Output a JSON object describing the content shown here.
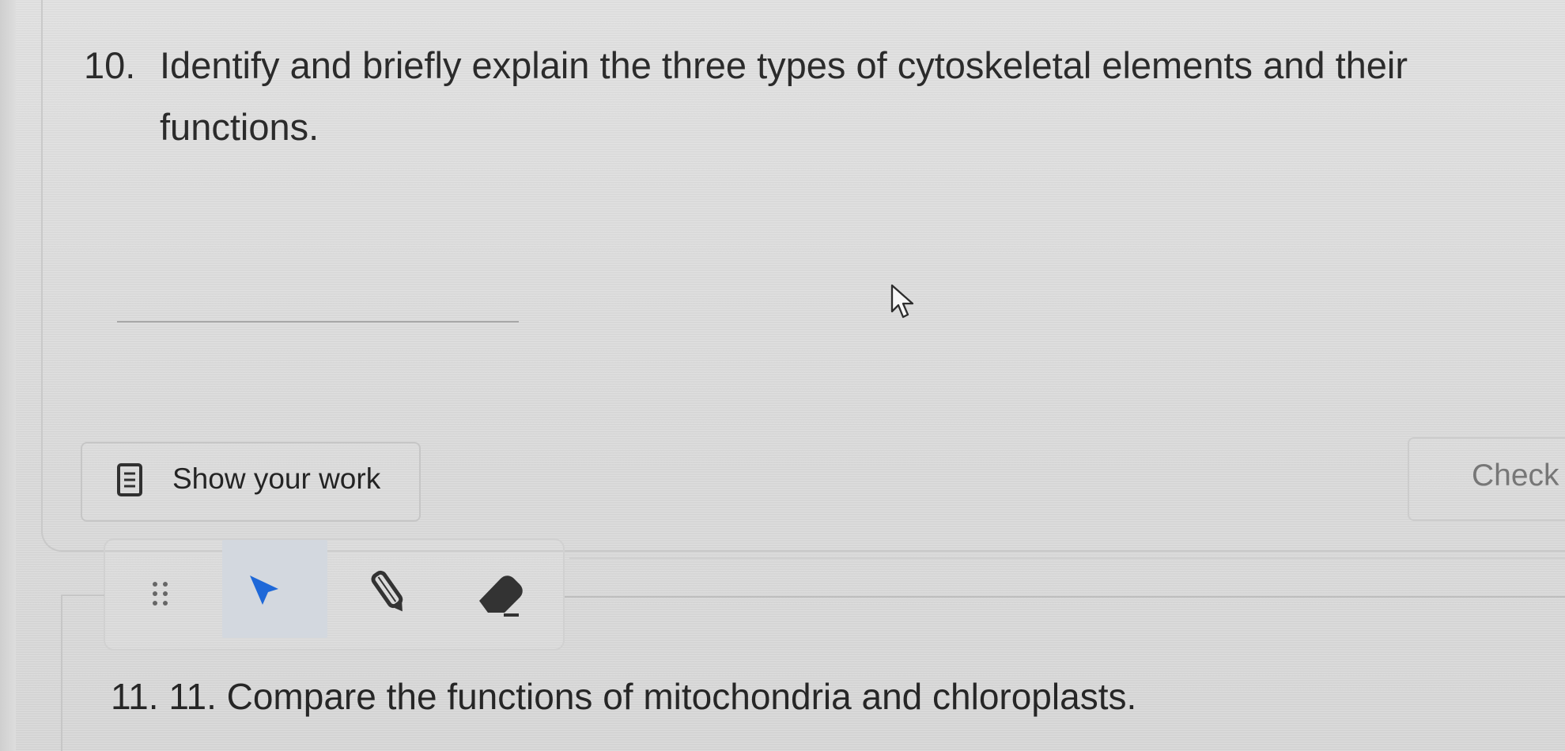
{
  "question_10": {
    "number": "10.",
    "text": "Identify and briefly explain the three types of cytoskeletal elements and their functions."
  },
  "actions": {
    "show_work_label": "Show your work",
    "check_label": "Check"
  },
  "toolbar": {
    "selected_tool": "pointer",
    "tools": [
      "pointer",
      "pen",
      "eraser"
    ]
  },
  "question_11": {
    "text": "11. 11. Compare the functions of mitochondria and chloroplasts."
  },
  "colors": {
    "page_background": "#dcdcdc",
    "text": "#2a2a2a",
    "muted_text": "#777777",
    "accent_blue": "#1e68d8",
    "border": "#c8c8c8"
  },
  "icons": {
    "work_icon": "document-icon",
    "drag_icon": "drag-handle-icon",
    "pointer_icon": "pointer-arrow-icon",
    "pen_icon": "pen-icon",
    "eraser_icon": "eraser-icon",
    "cursor_icon": "mouse-cursor-icon"
  }
}
